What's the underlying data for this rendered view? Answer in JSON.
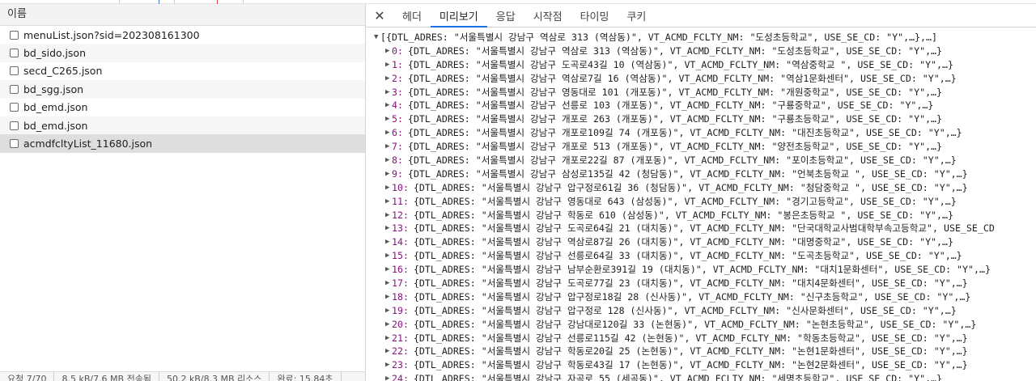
{
  "left_panel": {
    "header": "이름",
    "requests": [
      "menuList.json?sid=202308161300",
      "bd_sido.json",
      "secd_C265.json",
      "bd_sgg.json",
      "bd_emd.json",
      "bd_emd.json",
      "acmdfcltyList_11680.json"
    ],
    "selected_index": 6,
    "footer": [
      "요청 7/70",
      "8.5 kB/7.6 MB 전송됨",
      "50.2 kB/8.3 MB 리소스",
      "완료: 15.84초"
    ]
  },
  "detail_tabs": {
    "close_icon": "close-icon",
    "tabs": [
      "헤더",
      "미리보기",
      "응답",
      "시작점",
      "타이밍",
      "쿠키"
    ],
    "active_index": 1
  },
  "preview": {
    "summary": "[{DTL_ADRES: \"서울특별시 강남구 역삼로 313 (역삼동)\", VT_ACMD_FCLTY_NM: \"도성초등학교\", USE_SE_CD: \"Y\",…},…]",
    "items": [
      {
        "index": "0:",
        "text": "{DTL_ADRES: \"서울특별시 강남구 역삼로 313 (역삼동)\", VT_ACMD_FCLTY_NM: \"도성초등학교\", USE_SE_CD: \"Y\",…}"
      },
      {
        "index": "1:",
        "text": "{DTL_ADRES: \"서울특별시 강남구 도곡로43길 10 (역삼동)\", VT_ACMD_FCLTY_NM: \"역삼중학교 \", USE_SE_CD: \"Y\",…}"
      },
      {
        "index": "2:",
        "text": "{DTL_ADRES: \"서울특별시 강남구 역삼로7길 16 (역삼동)\", VT_ACMD_FCLTY_NM: \"역삼1문화센터\", USE_SE_CD: \"Y\",…}"
      },
      {
        "index": "3:",
        "text": "{DTL_ADRES: \"서울특별시 강남구 영동대로 101 (개포동)\", VT_ACMD_FCLTY_NM: \"개원중학교\", USE_SE_CD: \"Y\",…}"
      },
      {
        "index": "4:",
        "text": "{DTL_ADRES: \"서울특별시 강남구 선릉로 103 (개포동)\", VT_ACMD_FCLTY_NM: \"구룡중학교\", USE_SE_CD: \"Y\",…}"
      },
      {
        "index": "5:",
        "text": "{DTL_ADRES: \"서울특별시 강남구 개포로 263 (개포동)\", VT_ACMD_FCLTY_NM: \"구룡초등학교\", USE_SE_CD: \"Y\",…}"
      },
      {
        "index": "6:",
        "text": "{DTL_ADRES: \"서울특별시 강남구 개포로109길 74 (개포동)\", VT_ACMD_FCLTY_NM: \"대진초등학교\", USE_SE_CD: \"Y\",…}"
      },
      {
        "index": "7:",
        "text": "{DTL_ADRES: \"서울특별시 강남구 개포로 513 (개포동)\", VT_ACMD_FCLTY_NM: \"양전초등학교\", USE_SE_CD: \"Y\",…}"
      },
      {
        "index": "8:",
        "text": "{DTL_ADRES: \"서울특별시 강남구 개포로22길 87 (개포동)\", VT_ACMD_FCLTY_NM: \"포이초등학교\", USE_SE_CD: \"Y\",…}"
      },
      {
        "index": "9:",
        "text": "{DTL_ADRES: \"서울특별시 강남구 삼성로135길 42 (청담동)\", VT_ACMD_FCLTY_NM: \"언북초등학교 \", USE_SE_CD: \"Y\",…}"
      },
      {
        "index": "10:",
        "text": "{DTL_ADRES: \"서울특별시 강남구 압구정로61길 36 (청담동)\", VT_ACMD_FCLTY_NM: \"청담중학교 \", USE_SE_CD: \"Y\",…}"
      },
      {
        "index": "11:",
        "text": "{DTL_ADRES: \"서울특별시 강남구 영동대로 643 (삼성동)\", VT_ACMD_FCLTY_NM: \"경기고등학교\", USE_SE_CD: \"Y\",…}"
      },
      {
        "index": "12:",
        "text": "{DTL_ADRES: \"서울특별시 강남구 학동로 610 (삼성동)\", VT_ACMD_FCLTY_NM: \"봉은초등학교 \", USE_SE_CD: \"Y\",…}"
      },
      {
        "index": "13:",
        "text": "{DTL_ADRES: \"서울특별시 강남구 도곡로64길 21 (대치동)\", VT_ACMD_FCLTY_NM: \"단국대학교사범대학부속고등학교\", USE_SE_CD"
      },
      {
        "index": "14:",
        "text": "{DTL_ADRES: \"서울특별시 강남구 역삼로87길 26 (대치동)\", VT_ACMD_FCLTY_NM: \"대명중학교\", USE_SE_CD: \"Y\",…}"
      },
      {
        "index": "15:",
        "text": "{DTL_ADRES: \"서울특별시 강남구 선릉로64길 33 (대치동)\", VT_ACMD_FCLTY_NM: \"도곡초등학교\", USE_SE_CD: \"Y\",…}"
      },
      {
        "index": "16:",
        "text": "{DTL_ADRES: \"서울특별시 강남구 남부순환로391길 19 (대치동)\", VT_ACMD_FCLTY_NM: \"대치1문화센터\", USE_SE_CD: \"Y\",…}"
      },
      {
        "index": "17:",
        "text": "{DTL_ADRES: \"서울특별시 강남구 도곡로77길 23 (대치동)\", VT_ACMD_FCLTY_NM: \"대치4문화센터\", USE_SE_CD: \"Y\",…}"
      },
      {
        "index": "18:",
        "text": "{DTL_ADRES: \"서울특별시 강남구 압구정로18길 28 (신사동)\", VT_ACMD_FCLTY_NM: \"신구초등학교\", USE_SE_CD: \"Y\",…}"
      },
      {
        "index": "19:",
        "text": "{DTL_ADRES: \"서울특별시 강남구 압구정로 128 (신사동)\", VT_ACMD_FCLTY_NM: \"신사문화센터\", USE_SE_CD: \"Y\",…}"
      },
      {
        "index": "20:",
        "text": "{DTL_ADRES: \"서울특별시 강남구 강남대로120길 33 (논현동)\", VT_ACMD_FCLTY_NM: \"논현초등학교\", USE_SE_CD: \"Y\",…}"
      },
      {
        "index": "21:",
        "text": "{DTL_ADRES: \"서울특별시 강남구 선릉로115길 42 (논현동)\", VT_ACMD_FCLTY_NM: \"학동초등학교\", USE_SE_CD: \"Y\",…}"
      },
      {
        "index": "22:",
        "text": "{DTL_ADRES: \"서울특별시 강남구 학동로20길 25 (논현동)\", VT_ACMD_FCLTY_NM: \"논현1문화센터\", USE_SE_CD: \"Y\",…}"
      },
      {
        "index": "23:",
        "text": "{DTL_ADRES: \"서울특별시 강남구 학동로43길 17 (논현동)\", VT_ACMD_FCLTY_NM: \"논현2문화센터\", USE_SE_CD: \"Y\",…}"
      },
      {
        "index": "24:",
        "text": "{DTL_ADRES: \"서울특별시 강남구 자곡로 55 (세곡동)\", VT_ACMD_FCLTY_NM: \"세명초등학교\", USE_SE_CD: \"Y\",…}"
      }
    ]
  }
}
